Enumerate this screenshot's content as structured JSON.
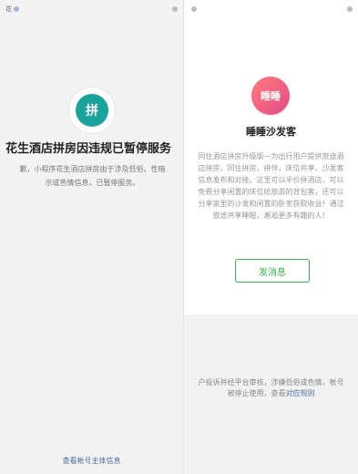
{
  "left": {
    "status": {
      "left_text": "花",
      "right_text": ""
    },
    "logo_text": "拼",
    "title": "花生酒店拼房因违规已暂停服务",
    "description_line1": "歉，小程序花生酒店拼房由于涉及低俗、性暗",
    "description_line2": "示或色情信息，已暂停服务。",
    "account_link": "查看帐号主体信息"
  },
  "right": {
    "status": {
      "left_text": "",
      "right_text": ""
    },
    "logo_text": "睡睡",
    "app_name": "睡睡沙发客",
    "description": "同住酒店拼房升级版—为出行用户提供旅途酒店拼房，同住拼房，拼伴，床位共享，沙发客信息发布和对接。这里可以半价拼酒店，可以免费分享闲置的床位给旅游的背包客，还可以分享家里的沙发和闲置的卧室获取收益！通过旅途共享睡眠，邂逅更多有趣的人！",
    "button_label": "发消息",
    "notice_part1": "户投诉并经平台审核，涉嫌低俗或色情，帐号",
    "notice_part2": "被停止使用，查看",
    "notice_link": "对应规则"
  }
}
